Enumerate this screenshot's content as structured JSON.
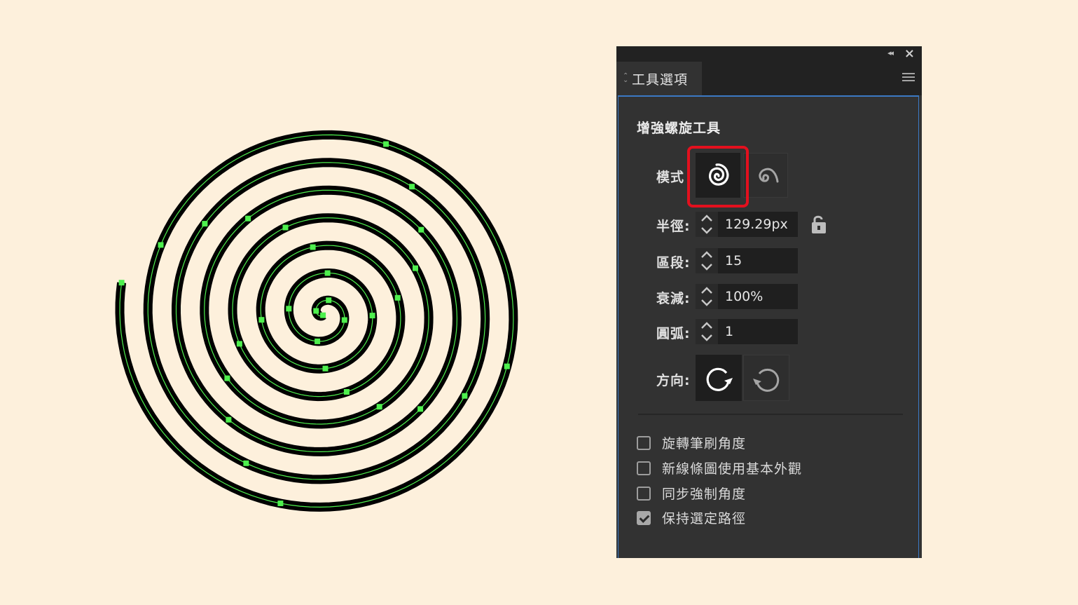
{
  "panel": {
    "tab_label": "工具選項",
    "tool_title": "增強螺旋工具",
    "mode_label": "模式",
    "radius": {
      "label": "半徑:",
      "value": "129.29px"
    },
    "segments": {
      "label": "區段:",
      "value": "15"
    },
    "decay": {
      "label": "衰減:",
      "value": "100%"
    },
    "arc": {
      "label": "圓弧:",
      "value": "1"
    },
    "direction_label": "方向:",
    "options": [
      {
        "label": "旋轉筆刷角度",
        "checked": false
      },
      {
        "label": "新線條圖使用基本外觀",
        "checked": false
      },
      {
        "label": "同步強制角度",
        "checked": false
      },
      {
        "label": "保持選定路徑",
        "checked": true
      }
    ]
  },
  "colors": {
    "canvas_bg": "#fdf0dc",
    "spiral_stroke": "#000000",
    "path_highlight": "#4ef04e",
    "selection_highlight": "#e3101e"
  },
  "icons": {
    "mode_selected": "spiral-icon",
    "mode_alt": "spiral-open-icon",
    "direction_clockwise": "rotate-clockwise-icon",
    "direction_counter": "rotate-counterclockwise-icon"
  }
}
